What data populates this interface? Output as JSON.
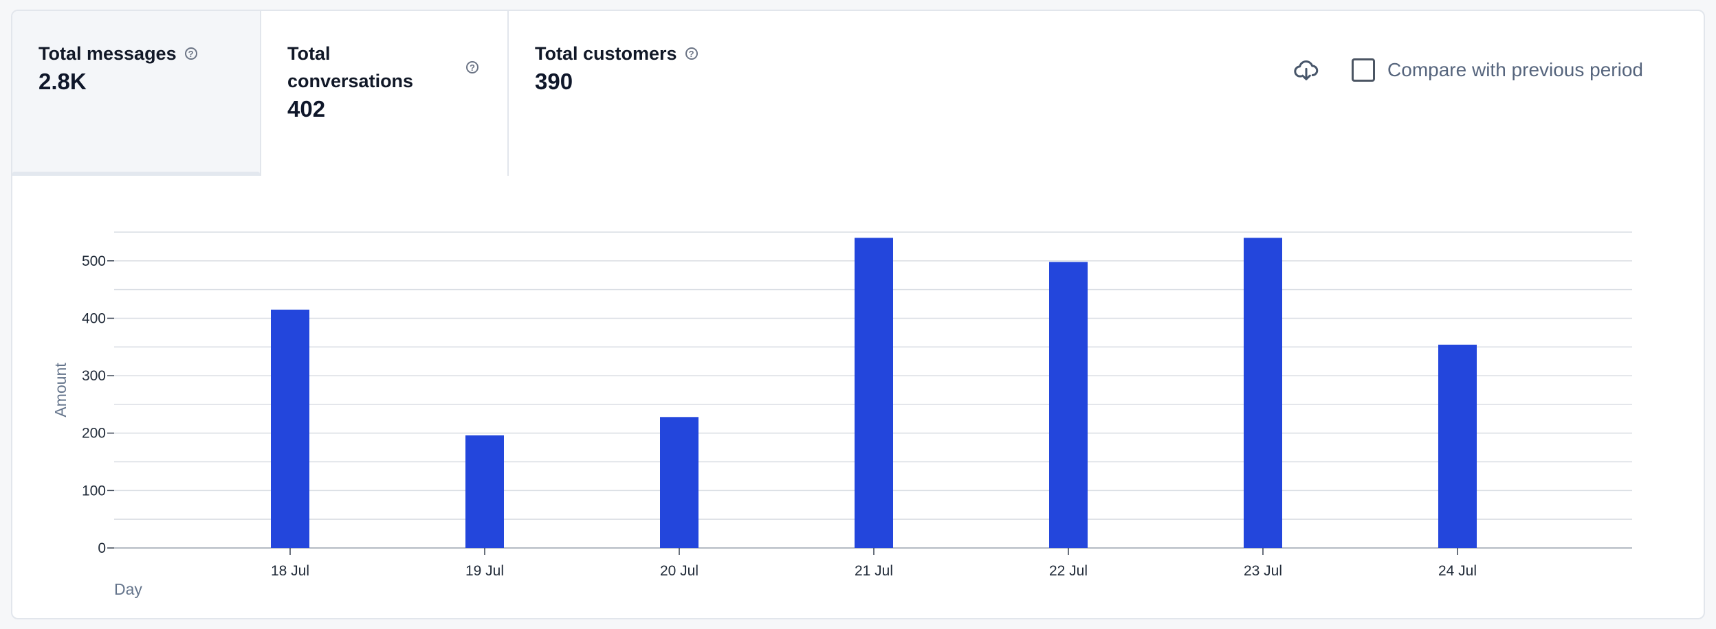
{
  "tabs": [
    {
      "label": "Total messages",
      "value": "2.8K",
      "active": true
    },
    {
      "label": "Total conversations",
      "value": "402",
      "active": false
    },
    {
      "label": "Total customers",
      "value": "390",
      "active": false
    }
  ],
  "toolbar": {
    "download_icon": "cloud-download-icon",
    "compare_label": "Compare with previous period",
    "compare_checked": false
  },
  "colors": {
    "bar": "#2346dc",
    "grid": "#d9dde3",
    "axis_title": "#64748b"
  },
  "chart_data": {
    "type": "bar",
    "title": "",
    "categories": [
      "18 Jul",
      "19 Jul",
      "20 Jul",
      "21 Jul",
      "22 Jul",
      "23 Jul",
      "24 Jul"
    ],
    "values": [
      415,
      196,
      228,
      540,
      498,
      540,
      354
    ],
    "xlabel": "Day",
    "ylabel": "Amount",
    "ylim": [
      0,
      550
    ],
    "yticks": [
      0,
      100,
      200,
      300,
      400,
      500
    ],
    "grid": true,
    "legend": "none"
  }
}
